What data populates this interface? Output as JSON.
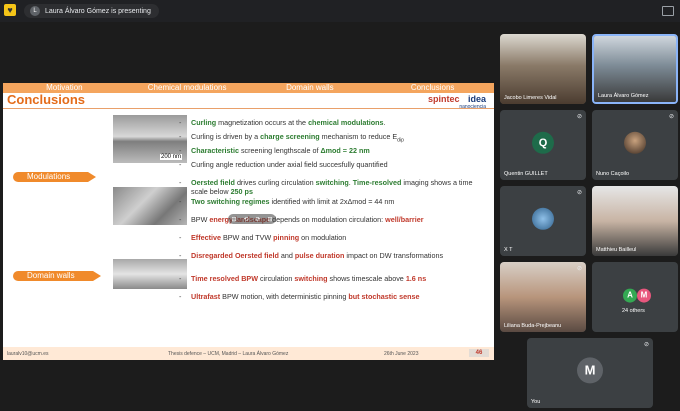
{
  "presenting_bar": {
    "logo": "♥",
    "avatar_initial": "L",
    "text": "Laura Álvaro Gómez is presenting"
  },
  "slide": {
    "nav": [
      "Motivation",
      "Chemical modulations",
      "Domain walls",
      "Conclusions"
    ],
    "title": "Conclusions",
    "brand_left": "spintec",
    "brand_right": "idea",
    "brand_sub": "nanociencia",
    "scale_label": "200 nm",
    "sections": [
      "Modulations",
      "Domain walls"
    ],
    "bullets": [
      {
        "parts": [
          {
            "t": "Curling ",
            "c": "g"
          },
          {
            "t": "magnetization occurs at the ",
            "c": "b"
          },
          {
            "t": "chemical modulations",
            "c": "g"
          },
          {
            "t": ".",
            "c": "b"
          }
        ]
      },
      {
        "parts": [
          {
            "t": "Curling is driven by a ",
            "c": "b"
          },
          {
            "t": "charge screening ",
            "c": "g"
          },
          {
            "t": "mechanism to reduce E",
            "c": "b"
          },
          {
            "t": "dip",
            "c": "b"
          }
        ]
      },
      {
        "parts": [
          {
            "t": "Characteristic ",
            "c": "g"
          },
          {
            "t": "screening lengthscale of ",
            "c": "b"
          },
          {
            "t": "Δmod = 22 nm",
            "c": "g"
          }
        ]
      },
      {
        "parts": [
          {
            "t": "Curling angle reduction under axial field succesfully quantified",
            "c": "b"
          }
        ]
      },
      {
        "parts": [
          {
            "t": "Oersted field ",
            "c": "g"
          },
          {
            "t": "drives curling circulation ",
            "c": "b"
          },
          {
            "t": "switching",
            "c": "g"
          },
          {
            "t": ". ",
            "c": "b"
          },
          {
            "t": "Time-resolved ",
            "c": "g"
          },
          {
            "t": "imaging shows a time scale below ",
            "c": "b"
          },
          {
            "t": "250 ps",
            "c": "g"
          }
        ]
      },
      {
        "parts": [
          {
            "t": "Two switching regimes ",
            "c": "g"
          },
          {
            "t": "identified with limit at 2xΔmod = 44 nm",
            "c": "b"
          }
        ]
      },
      {
        "parts": [
          {
            "t": "BPW ",
            "c": "b"
          },
          {
            "t": "energy landscape ",
            "c": "r"
          },
          {
            "t": "depends on modulation circulation: ",
            "c": "b"
          },
          {
            "t": "well/barrier",
            "c": "r"
          }
        ]
      },
      {
        "parts": [
          {
            "t": "Effective ",
            "c": "r"
          },
          {
            "t": "BPW and TVW ",
            "c": "b"
          },
          {
            "t": "pinning ",
            "c": "r"
          },
          {
            "t": "on modulation",
            "c": "b"
          }
        ]
      },
      {
        "parts": [
          {
            "t": "Disregarded Oersted field ",
            "c": "r"
          },
          {
            "t": "and ",
            "c": "b"
          },
          {
            "t": "pulse duration ",
            "c": "r"
          },
          {
            "t": "impact on DW transformations",
            "c": "b"
          }
        ]
      },
      {
        "parts": [
          {
            "t": "Time resolved BPW ",
            "c": "r"
          },
          {
            "t": "circulation ",
            "c": "b"
          },
          {
            "t": "switching ",
            "c": "r"
          },
          {
            "t": "shows timescale above ",
            "c": "b"
          },
          {
            "t": "1.6 ns",
            "c": "r"
          }
        ]
      },
      {
        "parts": [
          {
            "t": "Ultrafast ",
            "c": "r"
          },
          {
            "t": "BPW motion, with deterministic pinning ",
            "c": "b"
          },
          {
            "t": "but stochastic sense",
            "c": "r"
          }
        ]
      }
    ],
    "footer": {
      "email": "lauralv10@ucm.es",
      "center": "Thesis defence – UCM, Madrid – Laura Álvaro Gómez",
      "date": "26th June 2023",
      "page": "46"
    },
    "controls": [
      "⊡",
      "⟲",
      "⟳",
      "⊟"
    ]
  },
  "participants": [
    {
      "name": "Jacobo Limeres Vidal",
      "mic": "⊘"
    },
    {
      "name": "Laura Álvaro Gómez",
      "mic": "⊘"
    },
    {
      "name": "Quentin GUILLET",
      "initial": "Q",
      "mic": "⊘"
    },
    {
      "name": "Nuno Caçoilo",
      "mic": "⊘"
    },
    {
      "name": "X T",
      "mic": "⊘"
    },
    {
      "name": "Matthieu Bailleul",
      "mic": "⊘"
    },
    {
      "name": "Liliana Buda-Prejbeanu",
      "mic": "⊘"
    },
    {
      "others_label": "24 others",
      "initials": [
        "A",
        "M"
      ]
    },
    {
      "name": "You",
      "initial": "M",
      "mic": "⊘"
    }
  ],
  "colors": {
    "accent_orange": "#f08a2b",
    "green": "#2e7d32",
    "red": "#c0392b",
    "quentin_avatar": "#1e6b4a",
    "avatar_a": "#34a853",
    "avatar_m": "#e8577e",
    "you_avatar": "#5f6368"
  }
}
